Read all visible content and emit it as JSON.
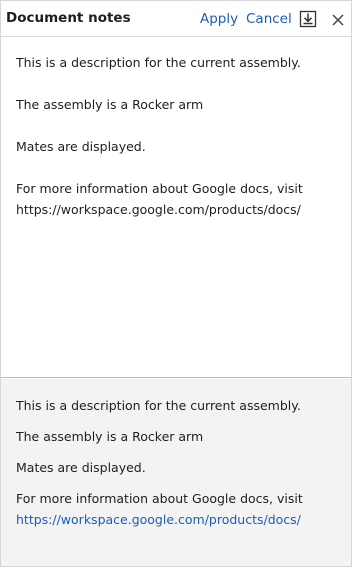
{
  "header": {
    "title": "Document notes",
    "apply_label": "Apply",
    "cancel_label": "Cancel",
    "save_icon": "download-save-icon",
    "close_icon": "close-icon"
  },
  "editor": {
    "line1": "This is a description for the current assembly.",
    "line2": "The assembly is a Rocker arm",
    "line3": "Mates are displayed.",
    "line4": "For more information about Google docs, visit",
    "line5": "https://workspace.google.com/products/docs/"
  },
  "preview": {
    "line1": "This is a description for the current assembly.",
    "line2": "The assembly is a Rocker arm",
    "line3": "Mates are displayed.",
    "line4": "For more information about Google docs, visit",
    "link_text": "https://workspace.google.com/products/docs/"
  },
  "colors": {
    "link": "#1a5fb4",
    "preview_background": "#f3f3f3"
  }
}
